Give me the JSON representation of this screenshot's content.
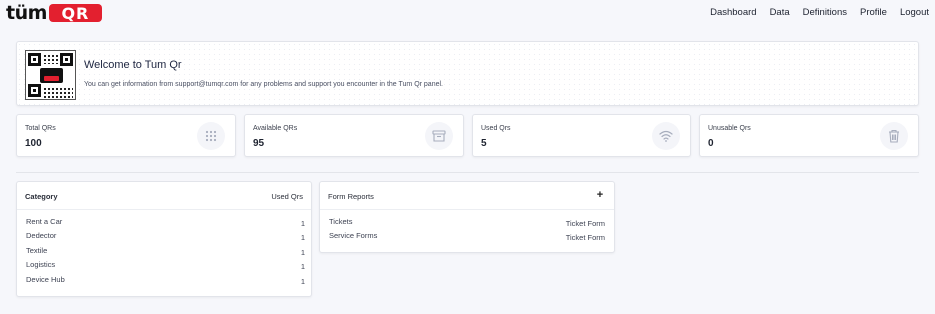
{
  "brand": {
    "word": "tüm",
    "box": "QR",
    "accent": "#e3202f"
  },
  "nav": [
    "Dashboard",
    "Data",
    "Definitions",
    "Profile",
    "Logout"
  ],
  "welcome": {
    "title": "Welcome to Tum Qr",
    "text": "You can get information from support@tumqr.com for any problems and support you encounter in the Tum Qr panel."
  },
  "stats": [
    {
      "label": "Total QRs",
      "value": "100",
      "icon": "grid-dots-icon"
    },
    {
      "label": "Available QRs",
      "value": "95",
      "icon": "inbox-icon"
    },
    {
      "label": "Used Qrs",
      "value": "5",
      "icon": "wifi-icon"
    },
    {
      "label": "Unusable Qrs",
      "value": "0",
      "icon": "trash-icon"
    }
  ],
  "category": {
    "header_left": "Category",
    "header_right": "Used Qrs",
    "rows": [
      {
        "name": "Rent a Car",
        "count": "1"
      },
      {
        "name": "Dedector",
        "count": "1"
      },
      {
        "name": "Textile",
        "count": "1"
      },
      {
        "name": "Logistics",
        "count": "1"
      },
      {
        "name": "Device Hub",
        "count": "1"
      }
    ]
  },
  "forms": {
    "title": "Form Reports",
    "add_icon": "+",
    "rows": [
      {
        "name": "Tickets",
        "type": "Ticket Form"
      },
      {
        "name": "Service Forms",
        "type": "Ticket Form"
      }
    ]
  }
}
